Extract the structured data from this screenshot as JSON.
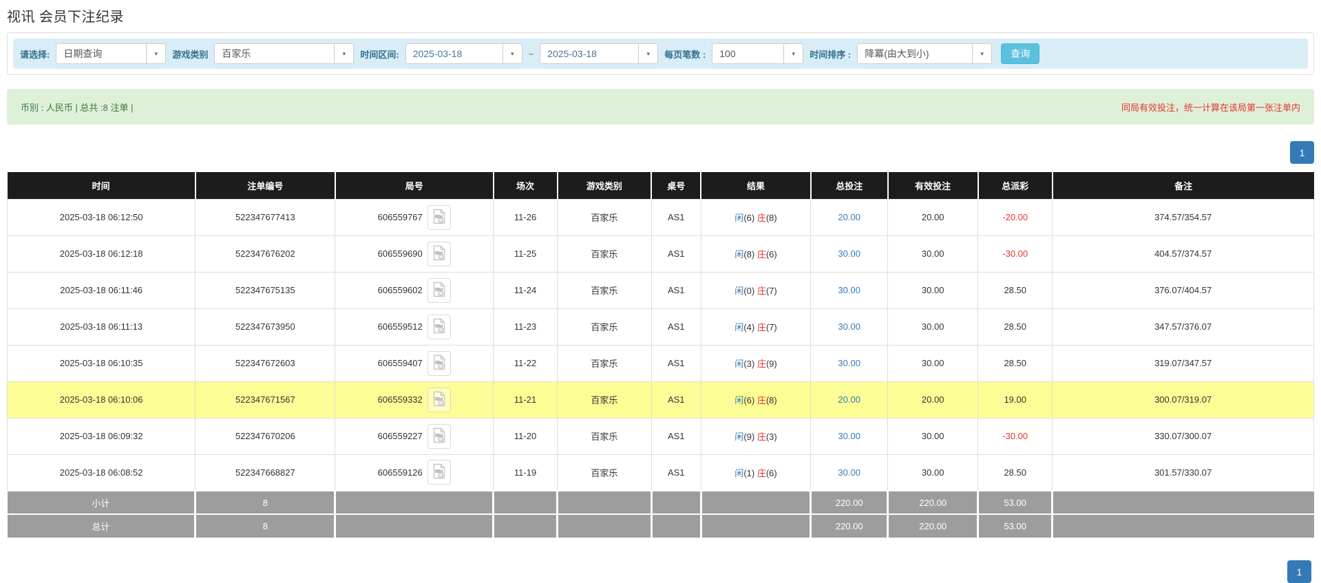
{
  "page": {
    "title": "视讯 会员下注纪录"
  },
  "filters": {
    "query_type_label": "请选择:",
    "query_type_value": "日期查询",
    "game_type_label": "游戏类别",
    "game_type_value": "百家乐",
    "time_range_label": "时间区间:",
    "date_from": "2025-03-18",
    "tilde": "~",
    "date_to": "2025-03-18",
    "page_size_label": "每页笔数 :",
    "page_size_value": "100",
    "sort_label": "时间排序 :",
    "sort_value": "降冪(由大到小)",
    "search_button": "查询"
  },
  "summary": {
    "left_text": "币别 : 人民币 | 总共 :8 注单 |",
    "right_note": "同局有效投注，统一计算在该局第一张注单内"
  },
  "pagination": {
    "top_page": "1",
    "bottom_page": "1"
  },
  "glyphs": {
    "dropdown_arrow": "▾"
  },
  "colors": {
    "filter_bar_bg": "#d9edf7",
    "filter_label": "#31708f",
    "search_button_bg": "#5bc0de",
    "summary_bg": "#dff0d8",
    "summary_text": "#3c763d",
    "alert_red": "#e53333",
    "link_blue": "#337ab7",
    "header_bg": "#1c1c1c",
    "footer_bg": "#9d9d9d",
    "highlight_row": "#fdfd96"
  },
  "table": {
    "columns": [
      "时间",
      "注单编号",
      "局号",
      "场次",
      "游戏类别",
      "桌号",
      "结果",
      "总投注",
      "有效投注",
      "总派彩",
      "备注"
    ],
    "rows": [
      {
        "time": "2025-03-18 06:12:50",
        "bet_id": "522347677413",
        "round_id": "606559767",
        "session": "11-26",
        "game": "百家乐",
        "table": "AS1",
        "result": {
          "player": "闲",
          "player_score": "6",
          "banker": "庄",
          "banker_score": "8"
        },
        "total_bet": "20.00",
        "valid_bet": "20.00",
        "payout": "-20.00",
        "remark": "374.57/354.57",
        "highlighted": false
      },
      {
        "time": "2025-03-18 06:12:18",
        "bet_id": "522347676202",
        "round_id": "606559690",
        "session": "11-25",
        "game": "百家乐",
        "table": "AS1",
        "result": {
          "player": "闲",
          "player_score": "8",
          "banker": "庄",
          "banker_score": "6"
        },
        "total_bet": "30.00",
        "valid_bet": "30.00",
        "payout": "-30.00",
        "remark": "404.57/374.57",
        "highlighted": false
      },
      {
        "time": "2025-03-18 06:11:46",
        "bet_id": "522347675135",
        "round_id": "606559602",
        "session": "11-24",
        "game": "百家乐",
        "table": "AS1",
        "result": {
          "player": "闲",
          "player_score": "0",
          "banker": "庄",
          "banker_score": "7"
        },
        "total_bet": "30.00",
        "valid_bet": "30.00",
        "payout": "28.50",
        "remark": "376.07/404.57",
        "highlighted": false
      },
      {
        "time": "2025-03-18 06:11:13",
        "bet_id": "522347673950",
        "round_id": "606559512",
        "session": "11-23",
        "game": "百家乐",
        "table": "AS1",
        "result": {
          "player": "闲",
          "player_score": "4",
          "banker": "庄",
          "banker_score": "7"
        },
        "total_bet": "30.00",
        "valid_bet": "30.00",
        "payout": "28.50",
        "remark": "347.57/376.07",
        "highlighted": false
      },
      {
        "time": "2025-03-18 06:10:35",
        "bet_id": "522347672603",
        "round_id": "606559407",
        "session": "11-22",
        "game": "百家乐",
        "table": "AS1",
        "result": {
          "player": "闲",
          "player_score": "3",
          "banker": "庄",
          "banker_score": "9"
        },
        "total_bet": "30.00",
        "valid_bet": "30.00",
        "payout": "28.50",
        "remark": "319.07/347.57",
        "highlighted": false
      },
      {
        "time": "2025-03-18 06:10:06",
        "bet_id": "522347671567",
        "round_id": "606559332",
        "session": "11-21",
        "game": "百家乐",
        "table": "AS1",
        "result": {
          "player": "闲",
          "player_score": "6",
          "banker": "庄",
          "banker_score": "8"
        },
        "total_bet": "20.00",
        "valid_bet": "20.00",
        "payout": "19.00",
        "remark": "300.07/319.07",
        "highlighted": true
      },
      {
        "time": "2025-03-18 06:09:32",
        "bet_id": "522347670206",
        "round_id": "606559227",
        "session": "11-20",
        "game": "百家乐",
        "table": "AS1",
        "result": {
          "player": "闲",
          "player_score": "9",
          "banker": "庄",
          "banker_score": "3"
        },
        "total_bet": "30.00",
        "valid_bet": "30.00",
        "payout": "-30.00",
        "remark": "330.07/300.07",
        "highlighted": false
      },
      {
        "time": "2025-03-18 06:08:52",
        "bet_id": "522347668827",
        "round_id": "606559126",
        "session": "11-19",
        "game": "百家乐",
        "table": "AS1",
        "result": {
          "player": "闲",
          "player_score": "1",
          "banker": "庄",
          "banker_score": "6"
        },
        "total_bet": "30.00",
        "valid_bet": "30.00",
        "payout": "28.50",
        "remark": "301.57/330.07",
        "highlighted": false
      }
    ],
    "footer": [
      {
        "label": "小计",
        "bet_count": "8",
        "total_bet": "220.00",
        "valid_bet": "220.00",
        "payout": "53.00"
      },
      {
        "label": "总计",
        "bet_count": "8",
        "total_bet": "220.00",
        "valid_bet": "220.00",
        "payout": "53.00"
      }
    ]
  }
}
